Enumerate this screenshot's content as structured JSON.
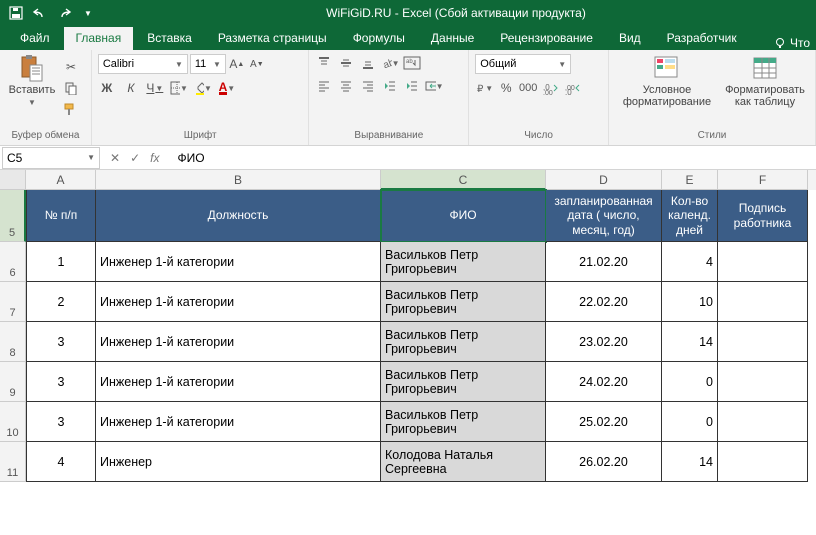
{
  "titlebar": {
    "title": "WiFiGiD.RU - Excel (Сбой активации продукта)"
  },
  "tabs": {
    "file": "Файл",
    "home": "Главная",
    "insert": "Вставка",
    "pagelayout": "Разметка страницы",
    "formulas": "Формулы",
    "data": "Данные",
    "review": "Рецензирование",
    "view": "Вид",
    "developer": "Разработчик",
    "tell": "Что"
  },
  "ribbon": {
    "clipboard": {
      "paste": "Вставить",
      "group": "Буфер обмена"
    },
    "font": {
      "name": "Calibri",
      "size": "11",
      "group": "Шрифт",
      "bold": "Ж",
      "italic": "К",
      "underline": "Ч"
    },
    "alignment": {
      "group": "Выравнивание"
    },
    "number": {
      "format": "Общий",
      "group": "Число"
    },
    "styles": {
      "cond": "Условное форматирование",
      "table": "Форматировать как таблицу",
      "group": "Стили"
    }
  },
  "formulabar": {
    "name": "C5",
    "value": "ФИО",
    "fx": "fx"
  },
  "colheads": [
    "A",
    "B",
    "C",
    "D",
    "E",
    "F"
  ],
  "header_row_num": "5",
  "headers": {
    "A": "№ п/п",
    "B": "Должность",
    "C": "ФИО",
    "D": "запланированная дата ( число, месяц, год)",
    "E": "Кол-во календ. дней",
    "F": "Подпись работника"
  },
  "rows": [
    {
      "rn": "6",
      "A": "1",
      "B": "Инженер 1-й категории",
      "C": "Васильков Петр Григорьевич",
      "D": "21.02.20",
      "E": "4",
      "F": ""
    },
    {
      "rn": "7",
      "A": "2",
      "B": "Инженер 1-й категории",
      "C": "Васильков Петр Григорьевич",
      "D": "22.02.20",
      "E": "10",
      "F": ""
    },
    {
      "rn": "8",
      "A": "3",
      "B": "Инженер 1-й категории",
      "C": "Васильков Петр Григорьевич",
      "D": "23.02.20",
      "E": "14",
      "F": ""
    },
    {
      "rn": "9",
      "A": "3",
      "B": "Инженер 1-й категории",
      "C": "Васильков Петр Григорьевич",
      "D": "24.02.20",
      "E": "0",
      "F": ""
    },
    {
      "rn": "10",
      "A": "3",
      "B": "Инженер 1-й категории",
      "C": "Васильков Петр Григорьевич",
      "D": "25.02.20",
      "E": "0",
      "F": ""
    },
    {
      "rn": "11",
      "A": "4",
      "B": "Инженер",
      "C": "Колодова Наталья Сергеевна",
      "D": "26.02.20",
      "E": "14",
      "F": ""
    }
  ]
}
